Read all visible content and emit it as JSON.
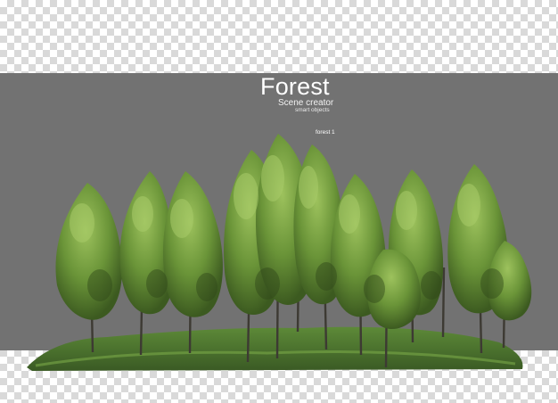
{
  "header": {
    "title": "Forest",
    "subtitle": "Scene creator",
    "tagline": "smart objects"
  },
  "scene": {
    "label": "forest 1"
  },
  "colors": {
    "panel": "#727272",
    "foliage_dark": "#3e5a22",
    "foliage_mid": "#5f8a32",
    "foliage_light": "#8fb555",
    "ground": "#4b7030"
  }
}
